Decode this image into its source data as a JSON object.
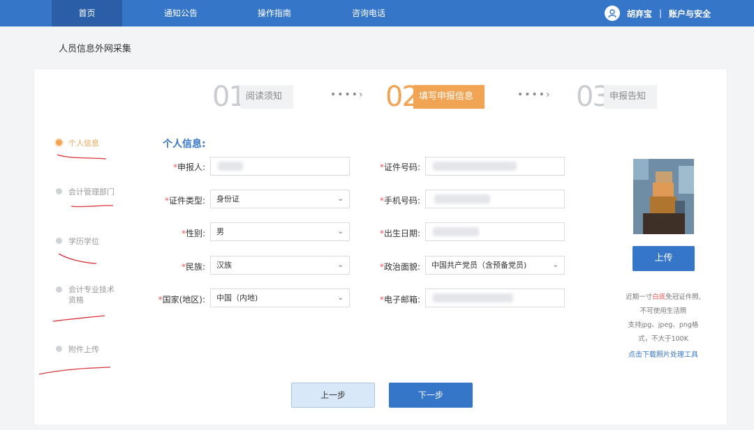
{
  "nav": {
    "items": [
      "首页",
      "通知公告",
      "操作指南",
      "咨询电话"
    ],
    "user_name": "胡弃宝",
    "separator": "|",
    "account_label": "账户与安全"
  },
  "page": {
    "title": "人员信息外网采集"
  },
  "steps": [
    {
      "num": "01",
      "label": "阅读须知"
    },
    {
      "num": "02",
      "label": "填写申报信息"
    },
    {
      "num": "03",
      "label": "申报告知"
    }
  ],
  "step_arrow": "••••›",
  "sidebar": {
    "items": [
      {
        "label": "个人信息"
      },
      {
        "label": "会计管理部门"
      },
      {
        "label": "学历学位"
      },
      {
        "label": "会计专业技术资格"
      },
      {
        "label": "附件上传"
      }
    ]
  },
  "section_title": "个人信息:",
  "form": {
    "required_mark": "*",
    "applicant": {
      "label": "申报人:",
      "value": ""
    },
    "id_type": {
      "label": "证件类型:",
      "value": "身份证"
    },
    "gender": {
      "label": "性别:",
      "value": "男"
    },
    "ethnicity": {
      "label": "民族:",
      "value": "汉族"
    },
    "country": {
      "label": "国家(地区):",
      "value": "中国（内地)"
    },
    "id_number": {
      "label": "证件号码:",
      "value": ""
    },
    "phone": {
      "label": "手机号码:",
      "value": ""
    },
    "birth_date": {
      "label": "出生日期:",
      "value": ""
    },
    "political_status": {
      "label": "政治面貌:",
      "value": "中国共产党员（含预备党员)"
    },
    "email": {
      "label": "电子邮箱:",
      "value": ""
    }
  },
  "photo": {
    "upload_label": "上传",
    "note_line1_pre": "近期一寸",
    "note_line1_red": "白底",
    "note_line1_post": "免冠证件照,",
    "note_line2": "不可使用生活照",
    "note_line3": "支持jpg、jpeg、png格",
    "note_line4": "式，不大于100K",
    "tool_link": "点击下载照片处理工具"
  },
  "buttons": {
    "prev": "上一步",
    "next": "下一步"
  },
  "colors": {
    "primary": "#3576c9",
    "accent": "#f0a454",
    "annotation": "#d9323a"
  }
}
